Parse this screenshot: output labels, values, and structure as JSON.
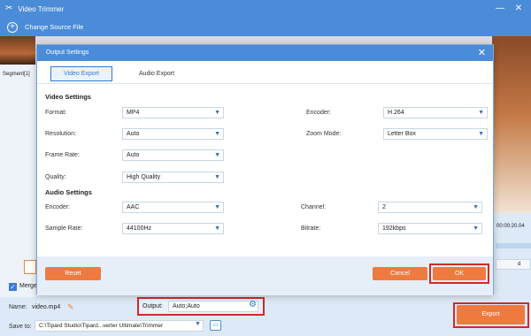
{
  "window": {
    "title": "Video Trimmer",
    "app_icon": "scissors-icon",
    "minimize_glyph": "—",
    "close_glyph": "✕"
  },
  "toolbar": {
    "add_icon": "plus-circle-icon",
    "add_glyph": "+",
    "add_label": "Change Source File"
  },
  "sidebar": {
    "segment_label": "Segment[1]"
  },
  "background": {
    "time_text": "00:00:20.04",
    "pill_text": "d",
    "merge_label": "Merge"
  },
  "dialog": {
    "title": "Output Settings",
    "close_glyph": "✕",
    "tabs": [
      {
        "label": "Video Export",
        "active": true
      },
      {
        "label": "Audio Export",
        "active": false
      }
    ],
    "video_settings": {
      "heading": "Video Settings",
      "format": {
        "label": "Format:",
        "value": "MP4"
      },
      "encoder": {
        "label": "Encoder:",
        "value": "H.264"
      },
      "resolution": {
        "label": "Resolution:",
        "value": "Auto"
      },
      "zoom_mode": {
        "label": "Zoom Mode:",
        "value": "Letter Box"
      },
      "frame_rate": {
        "label": "Frame Rate:",
        "value": "Auto"
      },
      "quality": {
        "label": "Quality:",
        "value": "High Quality"
      }
    },
    "audio_settings": {
      "heading": "Audio Settings",
      "encoder": {
        "label": "Encoder:",
        "value": "AAC"
      },
      "channel": {
        "label": "Channel:",
        "value": "2"
      },
      "sample_rate": {
        "label": "Sample Rate:",
        "value": "44100Hz"
      },
      "bitrate": {
        "label": "Bitrate:",
        "value": "192kbps"
      }
    },
    "buttons": {
      "reset": "Reset",
      "cancel": "Cancel",
      "ok": "OK"
    },
    "caret_glyph": "▼"
  },
  "bottom": {
    "name_label": "Name:",
    "name_value": "video.mp4",
    "edit_icon": "pencil-icon",
    "output_label": "Output:",
    "output_value": "Auto;Auto",
    "output_settings_icon": "gear-icon",
    "saveto_label": "Save to:",
    "saveto_value": "C:\\Tipard Studio\\Tipard...verter Ultimate\\Trimmer",
    "folder_icon": "folder-icon",
    "export_label": "Export"
  },
  "colors": {
    "titlebar": "#4b8cd8",
    "accent_orange": "#ee7a40",
    "highlight_red": "#d4282a",
    "tab_active": "#2f7ad8"
  }
}
